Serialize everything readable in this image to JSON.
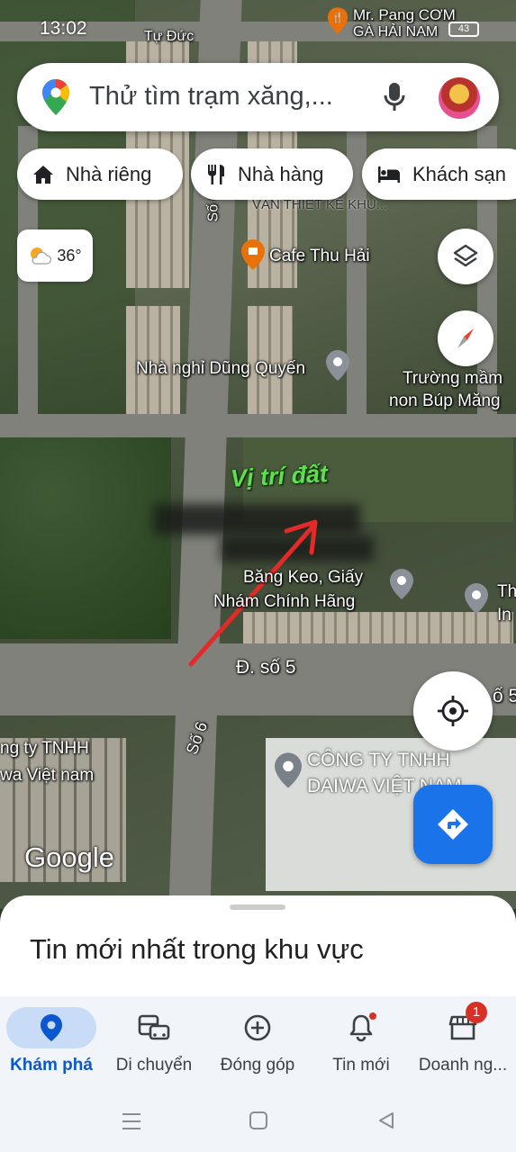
{
  "status": {
    "time": "13:02",
    "battery": "43"
  },
  "search": {
    "placeholder": "Thử tìm trạm xăng,..."
  },
  "chips": [
    {
      "label": "Nhà riêng",
      "icon": "home-icon"
    },
    {
      "label": "Nhà hàng",
      "icon": "restaurant-icon"
    },
    {
      "label": "Khách sạn",
      "icon": "hotel-icon"
    }
  ],
  "weather": {
    "temp": "36°",
    "icon": "partly-cloudy-icon"
  },
  "map": {
    "labels": {
      "mr_pang": "Mr. Pang CƠM",
      "ga_hai_nam": "GÀ HẢI NAM",
      "tu_duc": "Tự Đức",
      "so6_top": "Số 6",
      "van_thiet_ke": "VĂN THIẾT KẾ KHU...",
      "cafe": "Cafe Thu Hải",
      "nha_nghi": "Nhà nghỉ Dũng Quyến",
      "truong_mam_1": "Trường mầm",
      "truong_mam_2": "non Búp Măng",
      "vi_tri_dat": "Vị trí đất",
      "bang_keo_1": "Băng Keo, Giấy",
      "bang_keo_2": "Nhám Chính Hãng",
      "th_1": "Th",
      "th_2": "In",
      "duong_so5": "Đ. số 5",
      "so5_right": "ố 5",
      "so6_road": "Số 6",
      "cty_left_1": "ng ty TNHH",
      "cty_left_2": "wa Việt nam",
      "cty_daiwa_1": "CÔNG TY TNHH",
      "cty_daiwa_2": "DAIWA VIỆT NAM",
      "google": "Google"
    }
  },
  "sheet": {
    "title": "Tin mới nhất trong khu vực"
  },
  "nav": {
    "items": [
      {
        "label": "Khám phá",
        "icon": "explore-pin-icon",
        "active": true
      },
      {
        "label": "Di chuyển",
        "icon": "commute-icon"
      },
      {
        "label": "Đóng góp",
        "icon": "contribute-icon"
      },
      {
        "label": "Tin mới",
        "icon": "notifications-icon"
      },
      {
        "label": "Doanh ng...",
        "icon": "business-icon",
        "badge": "1"
      }
    ]
  },
  "colors": {
    "accent": "#1a73e8",
    "active_nav_bg": "#c9dcf7",
    "badge": "#d93025",
    "annotation_green": "#5ee04c",
    "arrow_red": "#e32a2a"
  }
}
